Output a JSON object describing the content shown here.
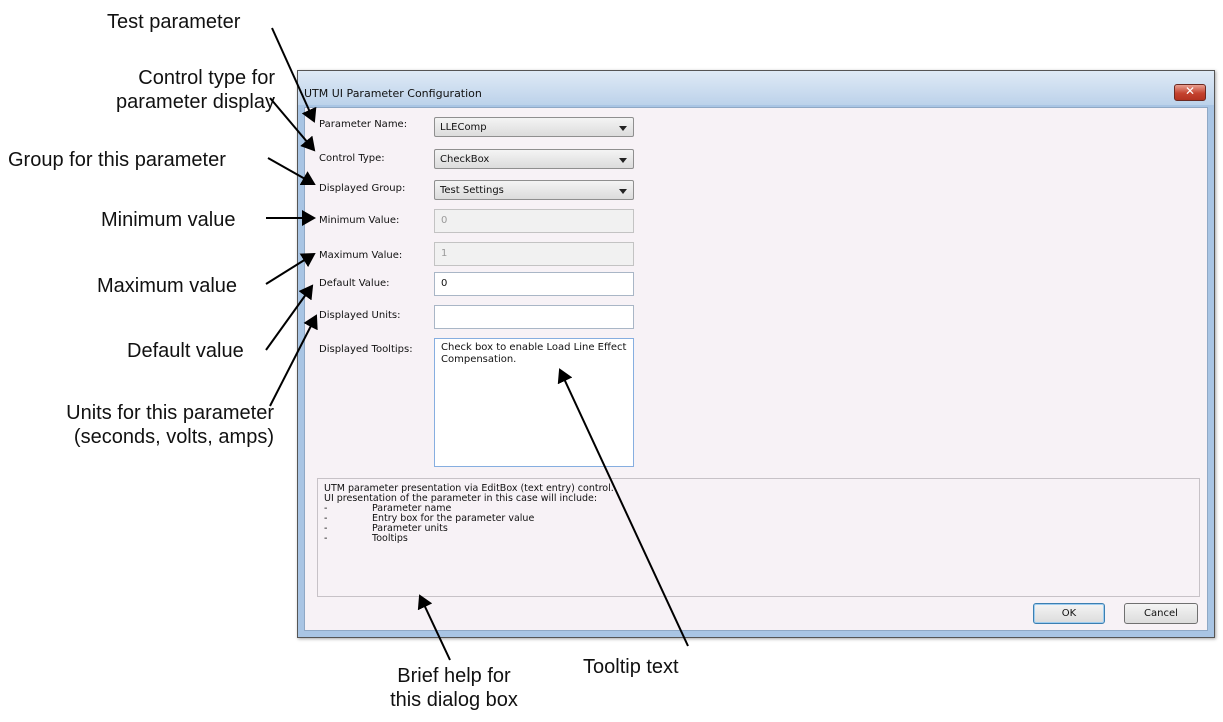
{
  "callouts": {
    "test_parameter": "Test parameter",
    "control_type_line1": "Control type for",
    "control_type_line2": "parameter display",
    "group": "Group for this parameter",
    "minimum": "Minimum value",
    "maximum": "Maximum value",
    "default": "Default value",
    "units_line1": "Units for this parameter",
    "units_line2": "(seconds, volts, amps)",
    "help_line1": "Brief help for",
    "help_line2": "this dialog box",
    "tooltip": "Tooltip text"
  },
  "dialog": {
    "title": "UTM UI Parameter Configuration",
    "close_glyph": "✕",
    "fields": {
      "parameter_name": {
        "label": "Parameter Name:",
        "value": "LLEComp"
      },
      "control_type": {
        "label": "Control Type:",
        "value": "CheckBox"
      },
      "displayed_group": {
        "label": "Displayed Group:",
        "value": "Test Settings"
      },
      "minimum_value": {
        "label": "Minimum Value:",
        "value": "0"
      },
      "maximum_value": {
        "label": "Maximum Value:",
        "value": "1"
      },
      "default_value": {
        "label": "Default Value:",
        "value": "0"
      },
      "displayed_units": {
        "label": "Displayed Units:",
        "value": ""
      },
      "displayed_tooltips": {
        "label": "Displayed Tooltips:",
        "value": "Check box to enable Load Line Effect Compensation."
      }
    },
    "help": {
      "line1": "UTM parameter presentation via EditBox (text entry) control.",
      "line2": "UI presentation of the parameter in this case will include:",
      "bullets": [
        "Parameter name",
        "Entry box for the parameter value",
        "Parameter units",
        "Tooltips"
      ],
      "dash": "-"
    },
    "buttons": {
      "ok": "OK",
      "cancel": "Cancel"
    }
  }
}
